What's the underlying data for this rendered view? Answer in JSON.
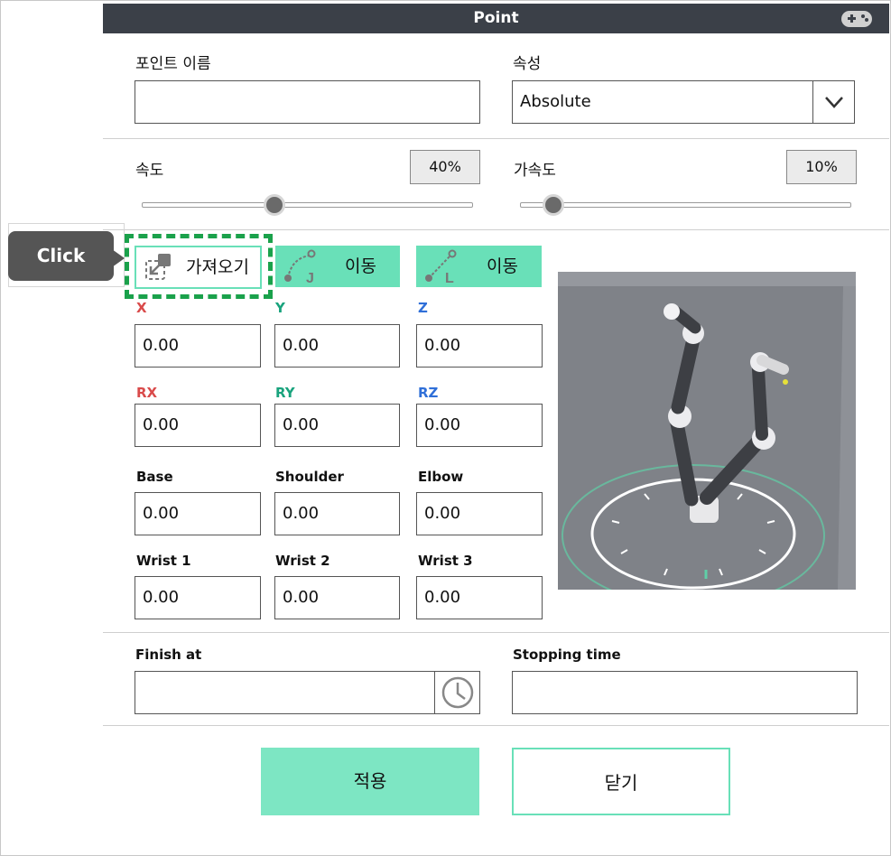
{
  "dialog": {
    "title": "Point"
  },
  "point_name": {
    "label": "포인트 이름",
    "value": ""
  },
  "attribute": {
    "label": "속성",
    "selected": "Absolute"
  },
  "speed": {
    "label": "속도",
    "value_text": "40%",
    "percent": 40
  },
  "acceleration": {
    "label": "가속도",
    "value_text": "10%",
    "percent": 10
  },
  "callout": {
    "text": "Click"
  },
  "actions": {
    "fetch_label": "가져오기",
    "move_j_label": "이동",
    "move_l_label": "이동",
    "move_j_glyph": "J",
    "move_l_glyph": "L"
  },
  "pose": {
    "x": {
      "label": "X",
      "value": "0.00",
      "color": "#d94a4a"
    },
    "y": {
      "label": "Y",
      "value": "0.00",
      "color": "#19a37d"
    },
    "z": {
      "label": "Z",
      "value": "0.00",
      "color": "#2f6fd8"
    },
    "rx": {
      "label": "RX",
      "value": "0.00",
      "color": "#d94a4a"
    },
    "ry": {
      "label": "RY",
      "value": "0.00",
      "color": "#19a37d"
    },
    "rz": {
      "label": "RZ",
      "value": "0.00",
      "color": "#2f6fd8"
    }
  },
  "joints": {
    "base": {
      "label": "Base",
      "value": "0.00"
    },
    "shoulder": {
      "label": "Shoulder",
      "value": "0.00"
    },
    "elbow": {
      "label": "Elbow",
      "value": "0.00"
    },
    "wrist1": {
      "label": "Wrist 1",
      "value": "0.00"
    },
    "wrist2": {
      "label": "Wrist 2",
      "value": "0.00"
    },
    "wrist3": {
      "label": "Wrist 3",
      "value": "0.00"
    }
  },
  "finish_at": {
    "label": "Finish at",
    "value": ""
  },
  "stopping_time": {
    "label": "Stopping time",
    "value": ""
  },
  "buttons": {
    "apply": "적용",
    "close": "닫기"
  },
  "colors": {
    "accent": "#69e0b8",
    "title_bar": "#3b4048",
    "callout": "#555555",
    "highlight": "#1aa14b"
  }
}
